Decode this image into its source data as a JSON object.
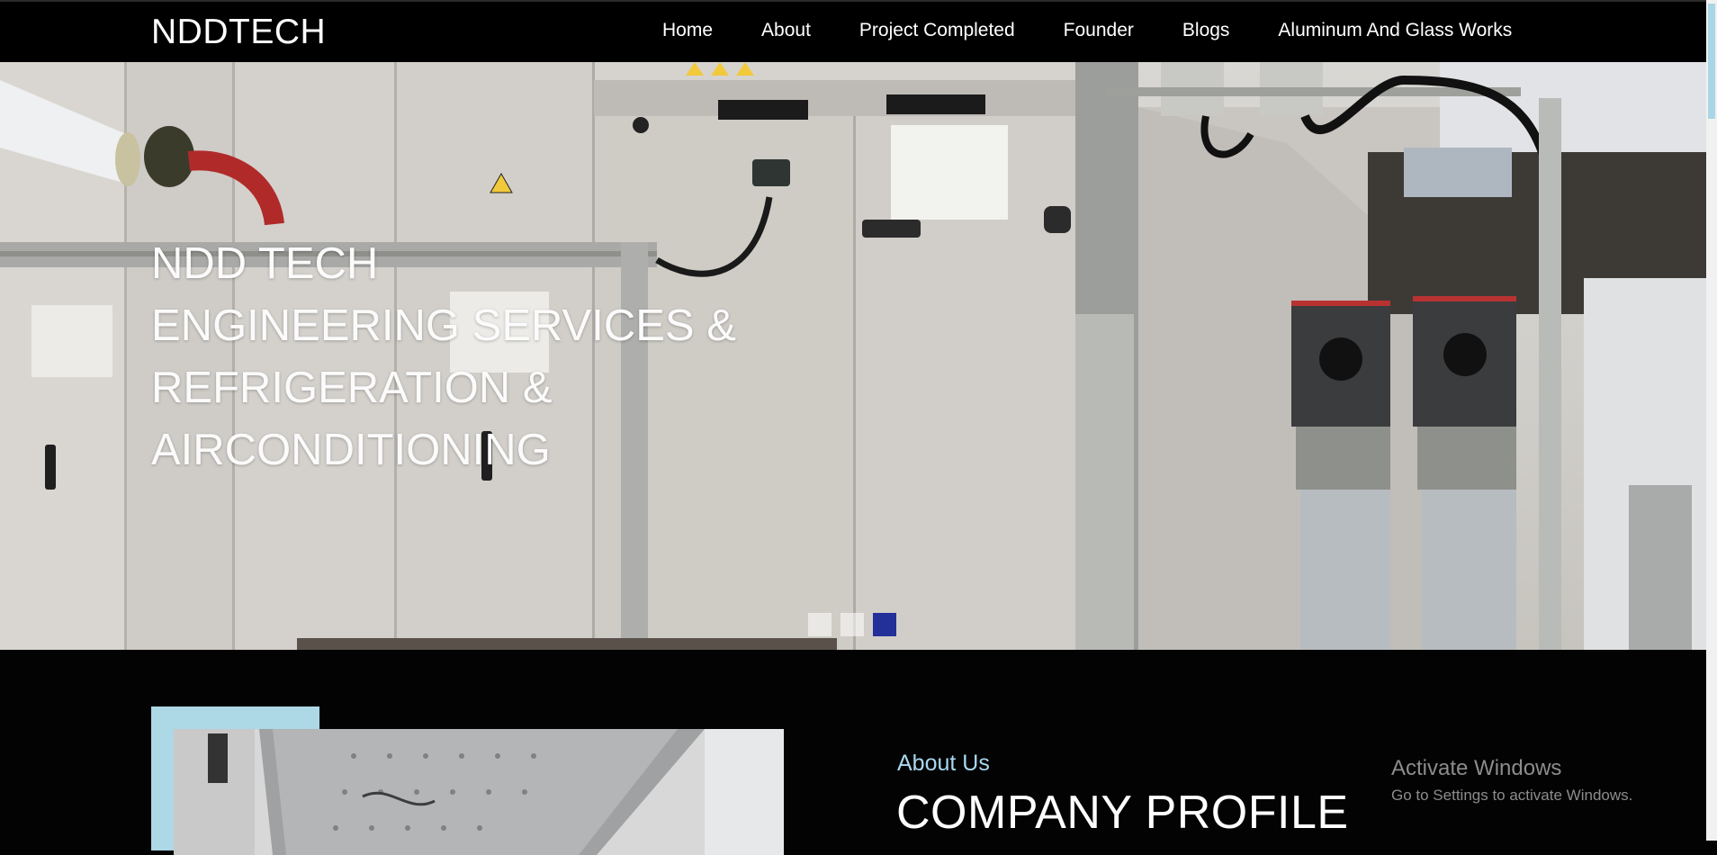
{
  "brand": "NDDTECH",
  "nav": {
    "items": [
      {
        "label": "Home"
      },
      {
        "label": "About"
      },
      {
        "label": "Project Completed"
      },
      {
        "label": "Founder"
      },
      {
        "label": "Blogs"
      },
      {
        "label": "Aluminum And Glass Works"
      }
    ]
  },
  "hero": {
    "lines": [
      "NDD TECH",
      "ENGINEERING SERVICES &",
      "REFRIGERATION &",
      "AIRCONDITIONING"
    ],
    "carousel": {
      "slide_count": 3,
      "active_slide": 3
    }
  },
  "about": {
    "label": "About Us",
    "title": "COMPANY PROFILE"
  },
  "watermark": {
    "title": "Activate Windows",
    "subtitle": "Go to Settings to activate Windows."
  },
  "colors": {
    "background": "#030303",
    "accent_light_blue": "#add8e6",
    "indicator_active": "#24309a"
  }
}
